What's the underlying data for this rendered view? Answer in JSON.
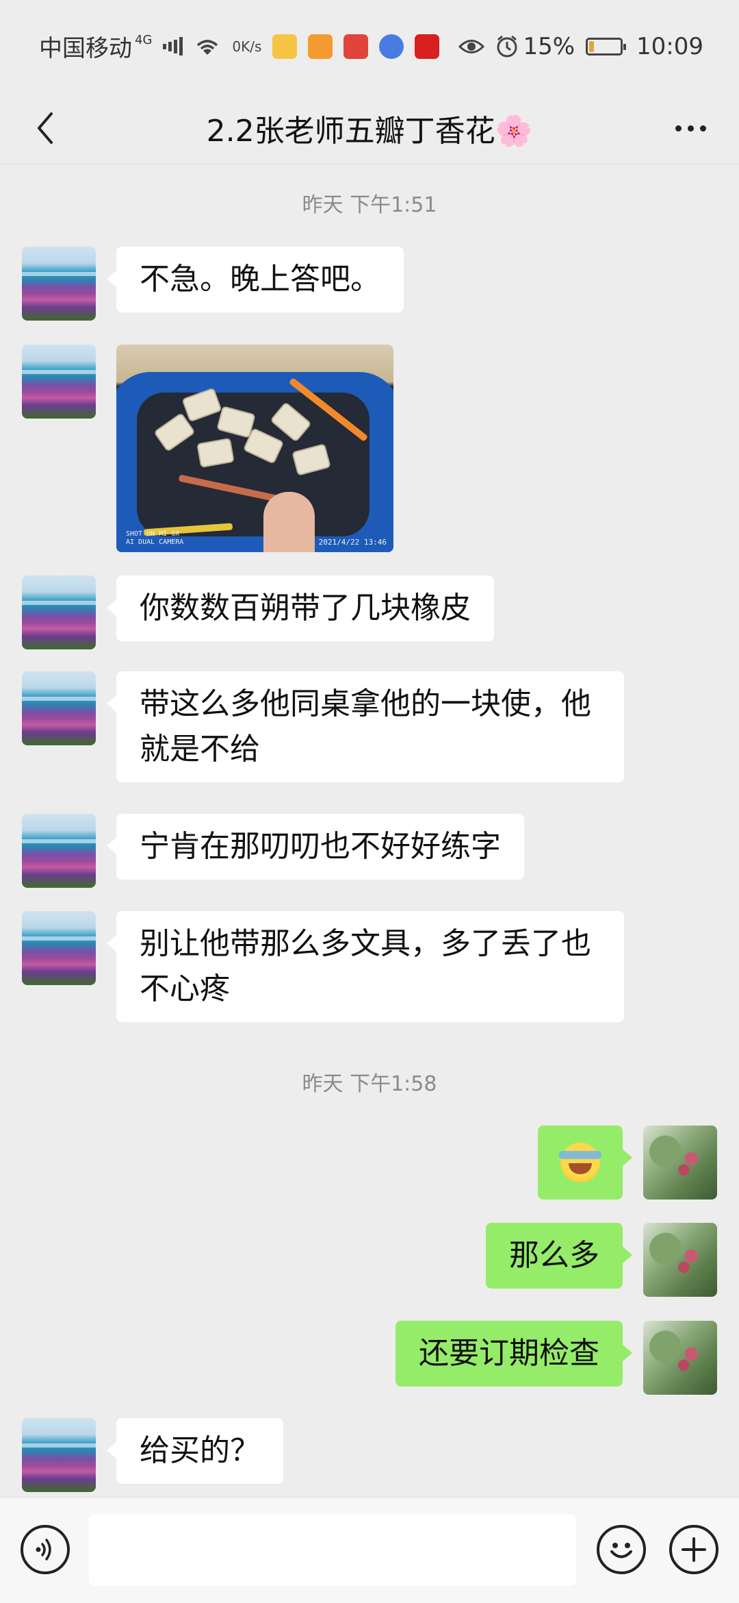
{
  "status_bar": {
    "carrier": "中国移动",
    "network": "4G",
    "speed_value": "0",
    "speed_unit": "K/s",
    "battery": "15%",
    "battery_level": 0.15,
    "time": "10:09",
    "app_icons": [
      "news-app-icon",
      "video-app-icon",
      "book-app-icon",
      "music-app-icon",
      "study-app-icon"
    ]
  },
  "header": {
    "title": "2.2张老师五瓣丁香花🌸"
  },
  "messages": [
    {
      "type": "time",
      "text": "昨天 下午1:51"
    },
    {
      "type": "text",
      "from": "other",
      "text": "不急。晚上答吧。"
    },
    {
      "type": "image",
      "from": "other",
      "stamp": "2021/4/22  13:46",
      "watermark": "SHOT ON MI 6X\nAI DUAL CAMERA"
    },
    {
      "type": "text",
      "from": "other",
      "text": "你数数百朔带了几块橡皮"
    },
    {
      "type": "text",
      "from": "other",
      "text": "带这么多他同桌拿他的一块使，他就是不给"
    },
    {
      "type": "text",
      "from": "other",
      "text": "宁肯在那叨叨也不好好练字"
    },
    {
      "type": "text",
      "from": "other",
      "text": "别让他带那么多文具，多了丢了也不心疼"
    },
    {
      "type": "time",
      "text": "昨天 下午1:58"
    },
    {
      "type": "emoji",
      "from": "me",
      "emoji": "laughing-crying-emoji"
    },
    {
      "type": "text",
      "from": "me",
      "text": "那么多"
    },
    {
      "type": "text",
      "from": "me",
      "text": "还要订期检查"
    },
    {
      "type": "text",
      "from": "other",
      "text": "给买的？"
    }
  ],
  "input_bar": {
    "voice_icon": "voice-icon",
    "text": "",
    "emoji_icon": "smiley-icon",
    "plus_icon": "plus-icon"
  },
  "colors": {
    "background": "#ededed",
    "incoming_bubble": "#ffffff",
    "outgoing_bubble": "#95ec69"
  }
}
